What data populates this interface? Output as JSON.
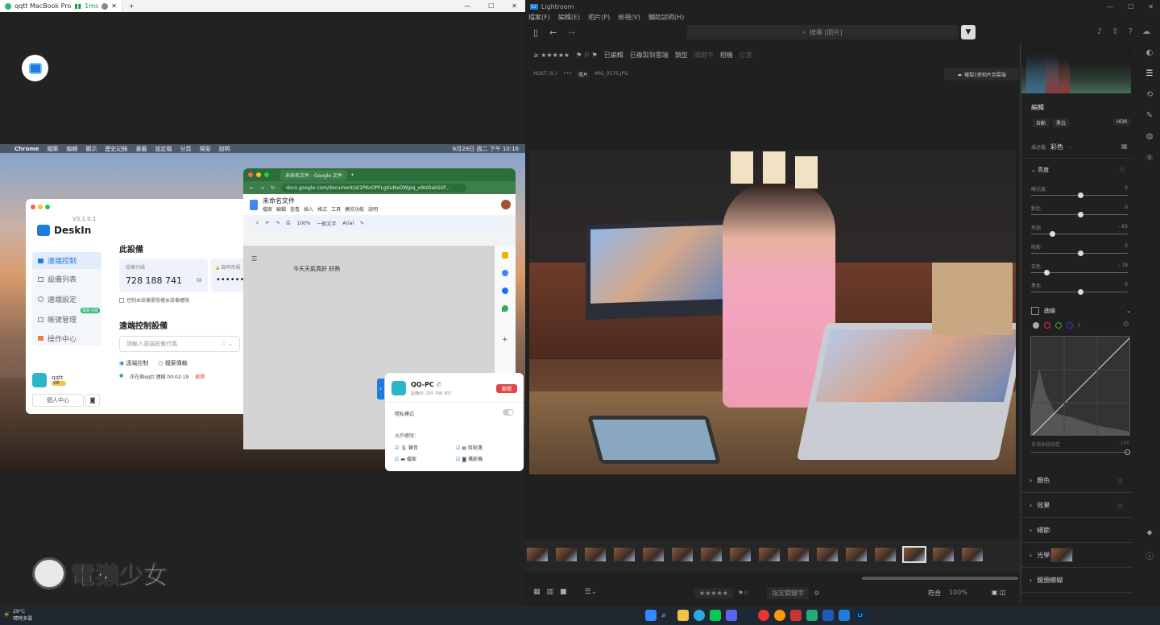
{
  "left_window": {
    "tab_title": "qqtt MacBook Pro",
    "latency": "1ms",
    "new_tab": "+",
    "window_controls": [
      "—",
      "☐",
      "✕"
    ]
  },
  "mac": {
    "menubar": [
      "Chrome",
      "檔案",
      "編輯",
      "顯示",
      "歷史記錄",
      "書籤",
      "設定檔",
      "分頁",
      "視窗",
      "說明"
    ],
    "clock": "6月28日 週二 下午 10:16"
  },
  "deskin": {
    "version": "V3.1.0.1",
    "brand": "DeskIn",
    "nav": [
      "遠端控制",
      "設備列表",
      "遠端設定",
      "帳號管理",
      "操作中心"
    ],
    "new_badge": "最新功能",
    "this_device": "此設備",
    "device_code_label": "設備代碼",
    "device_code": "728 188 741",
    "password_label": "臨時密碼",
    "password": "••••••",
    "checkbox_label": "控制本設備需授權本設備權限",
    "remote_title": "遠端控制設備",
    "input_placeholder": "請輸入遠端設備代碼",
    "radio1": "遠端控制",
    "radio2": "檔案傳輸",
    "status": "正在與qqtt 連線 00:02:19",
    "status_link": "斷開",
    "user": "qqtt",
    "user_badge": "VIP",
    "user_center": "個人中心"
  },
  "gdocs": {
    "tab_title": "未命名文件 - Google 文件",
    "url": "docs.google.com/document/d/1PKoOPFLgXuNxDWjpq_o9IzDakSUf...",
    "doc_title": "未命名文件",
    "menus": [
      "檔案",
      "編輯",
      "查看",
      "插入",
      "格式",
      "工具",
      "擴充功能",
      "說明"
    ],
    "zoom": "100%",
    "style": "一般文字",
    "font": "Arial",
    "body": "今天天氣真好 好熱"
  },
  "session": {
    "device": "QQ-PC",
    "device_id": "設備ID: 255 748 307",
    "end_button": "斷開",
    "privacy": "隱私模式",
    "allow_label": "允許權限：",
    "perms": [
      "聲音",
      "剪貼簿",
      "檔案",
      "攝影機"
    ]
  },
  "watermark": "電獺少女",
  "lightroom": {
    "app": "Lightroom",
    "menus": [
      "檔案(F)",
      "編輯(E)",
      "相片(P)",
      "檢視(V)",
      "輔助說明(H)"
    ],
    "search_placeholder": "搜尋 [照片]",
    "filters": [
      "已編輯",
      "已複製到雲端",
      "類型",
      "關鍵字",
      "相機",
      "位置"
    ],
    "path": [
      "HGST (X:)",
      "•••",
      "照片",
      "IMG_0575.JPG"
    ],
    "copy_cloud": "複製1張相片到雲端",
    "edit_title": "編輯",
    "auto": "自動",
    "bw": "黑白",
    "hdr": "HDR",
    "profile_label": "描述檔",
    "profile_value": "彩色",
    "light_section": "亮度",
    "sliders": [
      {
        "label": "曝光度",
        "value": "0",
        "pos": 0.5
      },
      {
        "label": "對比",
        "value": "0",
        "pos": 0.5
      },
      {
        "label": "亮部",
        "value": "- 63",
        "pos": 0.2
      },
      {
        "label": "陰影",
        "value": "0",
        "pos": 0.5
      },
      {
        "label": "白色",
        "value": "- 79",
        "pos": 0.14
      },
      {
        "label": "黑色",
        "value": "0",
        "pos": 0.5
      }
    ],
    "curve_title": "曲線",
    "curve_adjust": "目標曲線調整",
    "curve_val": "- 100",
    "sections": [
      "顏色",
      "效果",
      "細節",
      "光學",
      "鏡頭模糊"
    ],
    "fit": "符合",
    "zoom": "100%",
    "keywords": "指定關鍵字",
    "colors": {
      "accent": "#2b7bff"
    }
  },
  "taskbar": {
    "temp": "29°C",
    "weather": "晴時多雲"
  }
}
